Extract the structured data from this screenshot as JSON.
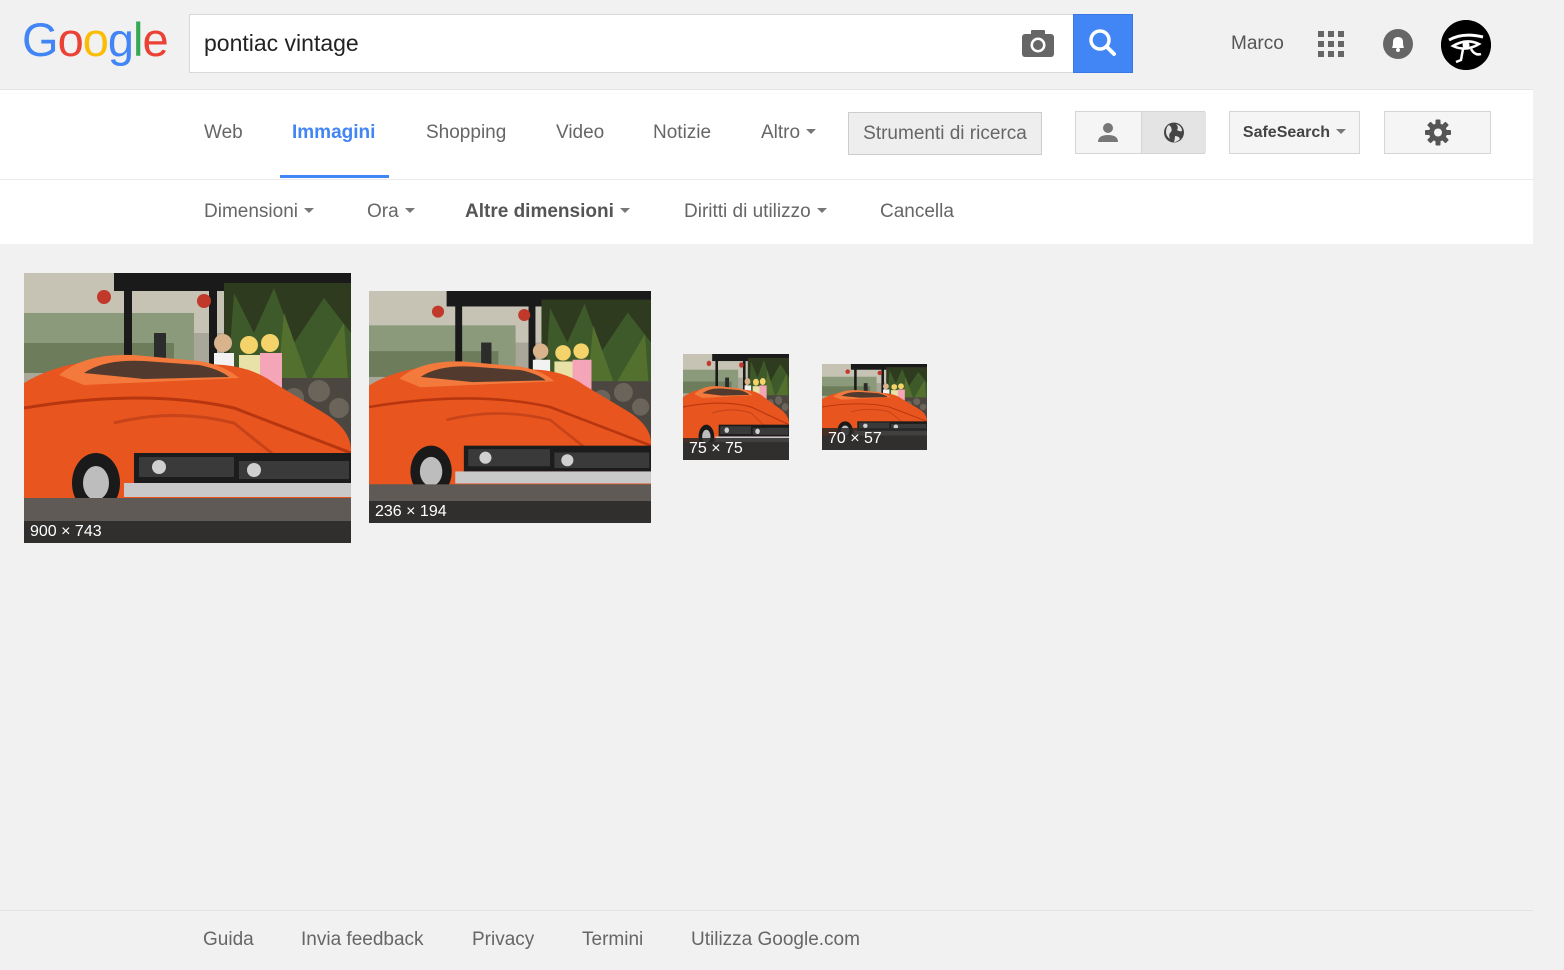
{
  "header": {
    "logo_letters": [
      {
        "char": "G",
        "color": "#4285f4"
      },
      {
        "char": "o",
        "color": "#ea4335"
      },
      {
        "char": "o",
        "color": "#fbbc05"
      },
      {
        "char": "g",
        "color": "#4285f4"
      },
      {
        "char": "l",
        "color": "#34a853"
      },
      {
        "char": "e",
        "color": "#ea4335"
      }
    ],
    "search_value": "pontiac vintage",
    "camera_icon": "camera-icon",
    "search_icon": "magnifier-icon",
    "user_name": "Marco",
    "apps_icon": "apps-grid-icon",
    "notifications_icon": "bell-icon",
    "avatar_icon": "eye-of-horus-icon"
  },
  "tabs": [
    {
      "label": "Web",
      "active": false
    },
    {
      "label": "Immagini",
      "active": true
    },
    {
      "label": "Shopping",
      "active": false
    },
    {
      "label": "Video",
      "active": false
    },
    {
      "label": "Notizie",
      "active": false
    },
    {
      "label": "Altro",
      "active": false,
      "dropdown": true
    }
  ],
  "search_tools_label": "Strumenti di ricerca",
  "view_toggle": {
    "left_icon": "person-icon",
    "right_icon": "globe-icon"
  },
  "safesearch_label": "SafeSearch",
  "settings_icon": "gear-icon",
  "tools": [
    {
      "label": "Dimensioni",
      "dropdown": true,
      "bold": false
    },
    {
      "label": "Ora",
      "dropdown": true,
      "bold": false
    },
    {
      "label": "Altre dimensioni",
      "dropdown": true,
      "bold": true
    },
    {
      "label": "Diritti di utilizzo",
      "dropdown": true,
      "bold": false
    },
    {
      "label": "Cancella",
      "dropdown": false,
      "bold": false
    }
  ],
  "results": [
    {
      "dims": "900 × 743"
    },
    {
      "dims": "236 × 194"
    },
    {
      "dims": "75 × 75"
    },
    {
      "dims": "70 × 57"
    }
  ],
  "footer": {
    "links": [
      "Guida",
      "Invia feedback",
      "Privacy",
      "Termini",
      "Utilizza Google.com"
    ]
  },
  "colors": {
    "accent": "#4285f4",
    "car": "#e8551f",
    "background": "#f1f1f1"
  }
}
